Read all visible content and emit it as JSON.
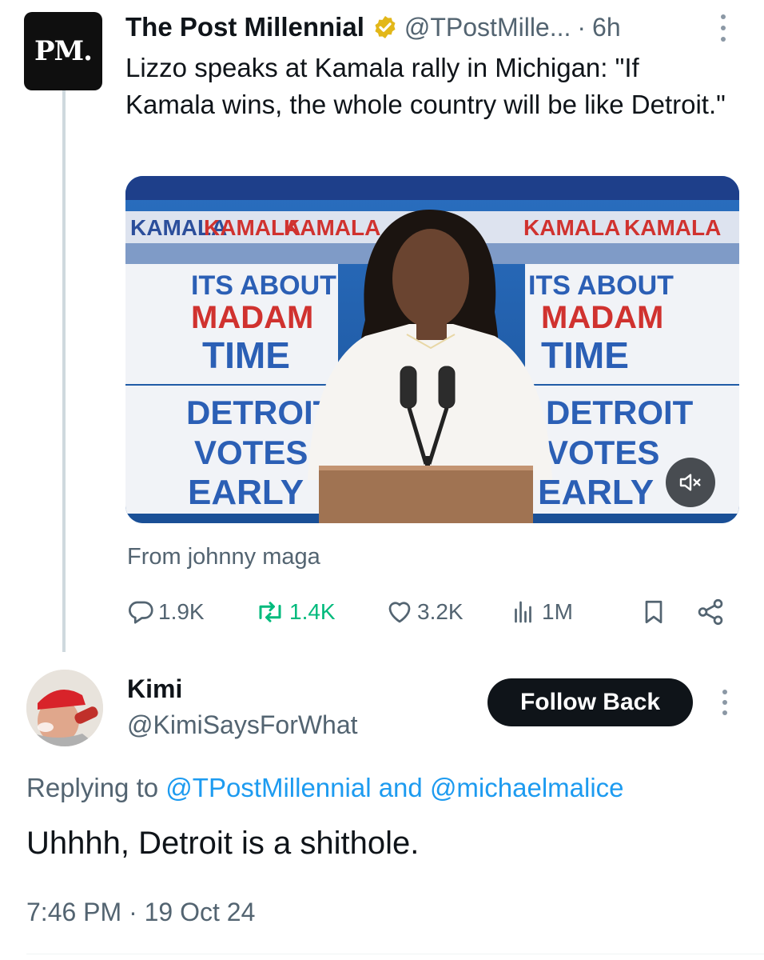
{
  "post": {
    "author": "The Post Millennial",
    "avatar_text": "PM.",
    "handle": "@TPostMille...",
    "separator": "·",
    "time": "6h",
    "text": "Lizzo speaks at Kamala rally in Michigan: \"If Kamala wins, the whole country will be like Detroit.\"",
    "media": {
      "signs": [
        "KAMALA",
        "KAMALA",
        "KAMALA",
        "KAMALA",
        "KAMALA"
      ],
      "poster_lines": [
        "ITS ABOUT",
        "MADAM",
        "TIME",
        "DETROIT",
        "VOTES",
        "EARLY"
      ],
      "mute_icon": "speaker-muted-icon"
    },
    "source": "From johnny maga",
    "actions": {
      "replies": "1.9K",
      "reposts": "1.4K",
      "likes": "3.2K",
      "views": "1M"
    }
  },
  "reply": {
    "name": "Kimi",
    "handle": "@KimiSaysForWhat",
    "follow_label": "Follow Back",
    "replying_prefix": "Replying to",
    "replying_to_1": "@TPostMillennial",
    "replying_and": "and",
    "replying_to_2": "@michaelmalice",
    "text": "Uhhhh, Detroit is a shithole.",
    "timestamp": "7:46 PM · 19 Oct 24"
  },
  "colors": {
    "text": "#0f1419",
    "secondary": "#536471",
    "link": "#1d9bf0",
    "repost": "#00ba7c",
    "verified_gold": "#e2b719"
  }
}
